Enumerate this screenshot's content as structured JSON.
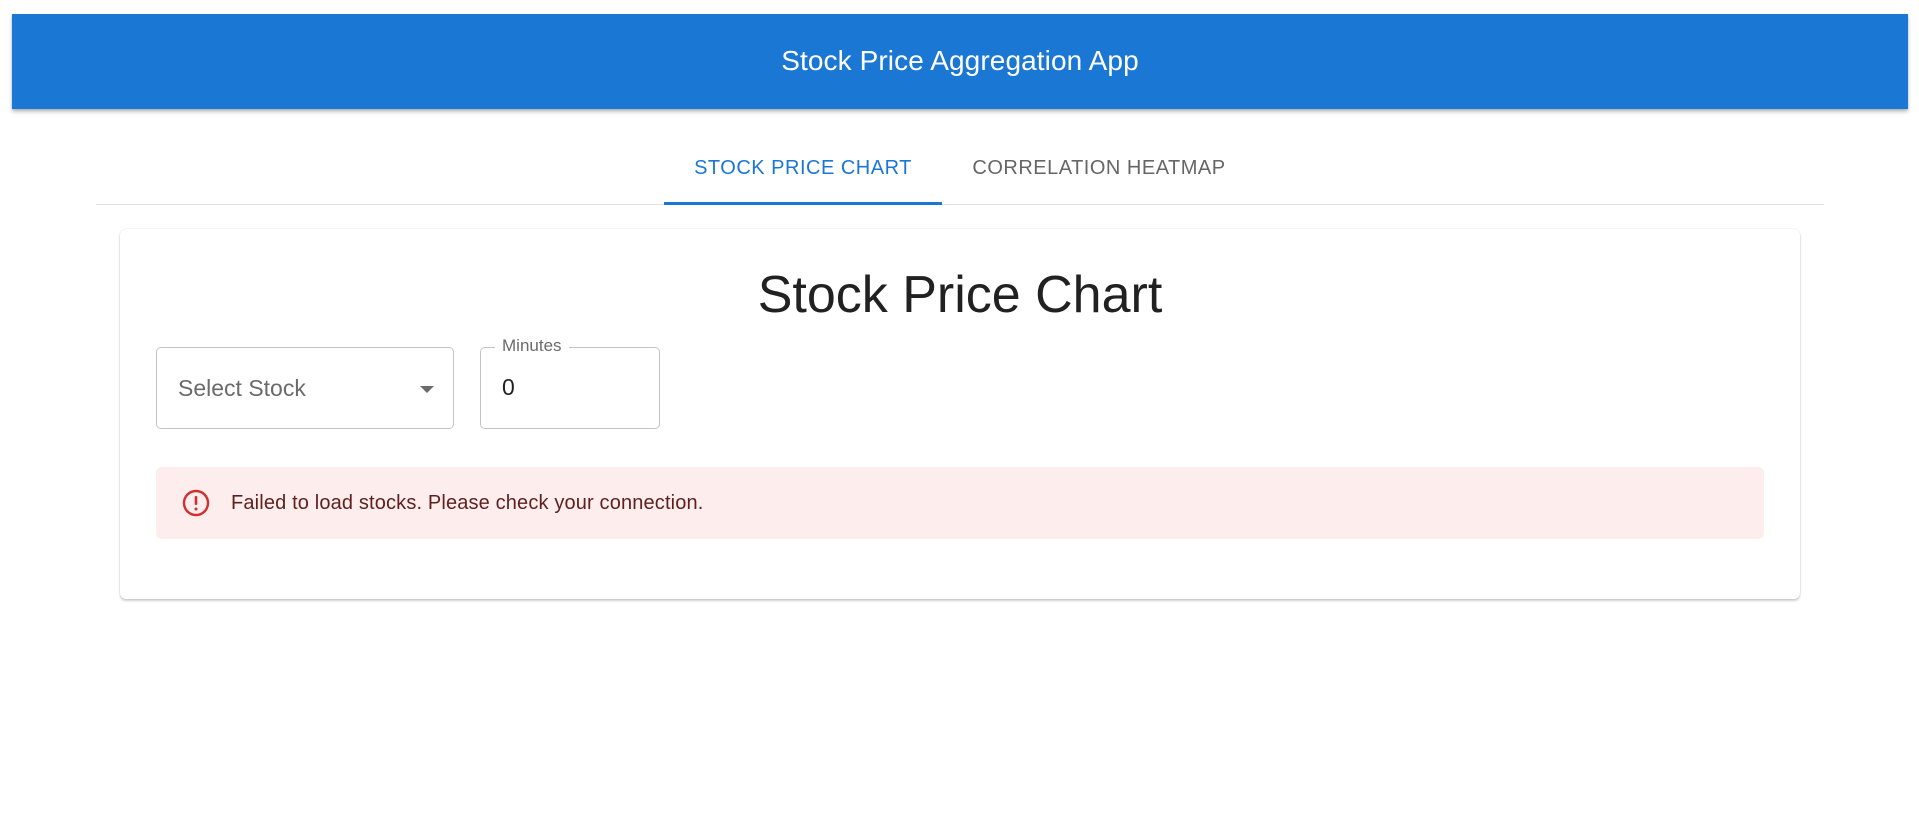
{
  "header": {
    "title": "Stock Price Aggregation App",
    "background_color": "#1b77d4"
  },
  "tabs": [
    {
      "label": "STOCK PRICE CHART",
      "active": true
    },
    {
      "label": "CORRELATION HEATMAP",
      "active": false
    }
  ],
  "main": {
    "title": "Stock Price Chart",
    "stock_select": {
      "placeholder": "Select Stock",
      "icon": "chevron-down-icon"
    },
    "minutes_field": {
      "label": "Minutes",
      "value": "0"
    },
    "alert": {
      "severity": "error",
      "icon": "error-outline-icon",
      "message": "Failed to load stocks. Please check your connection.",
      "background_color": "#fdeded",
      "icon_color": "#d32f2f",
      "text_color": "#5f2120"
    }
  },
  "colors": {
    "accent": "#1b77d4"
  }
}
